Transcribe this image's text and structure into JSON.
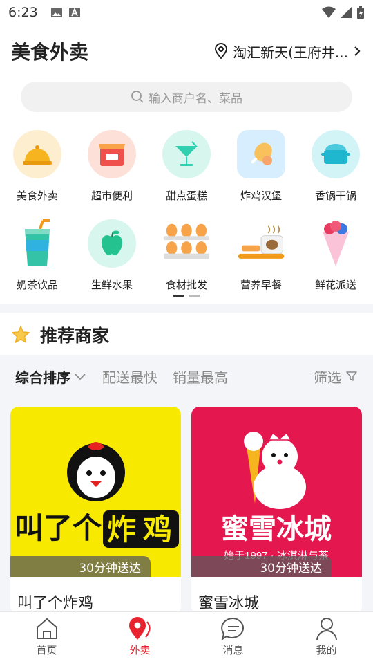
{
  "status_bar": {
    "time": "6:23"
  },
  "header": {
    "title": "美食外卖",
    "location": "淘汇新天(王府井..."
  },
  "search": {
    "placeholder": "输入商户名、菜品"
  },
  "categories": [
    {
      "label": "美食外卖",
      "icon": "dish-cloche-icon",
      "bg": "#fdeecf"
    },
    {
      "label": "超市便利",
      "icon": "store-icon",
      "bg": "#fde1d9"
    },
    {
      "label": "甜点蛋糕",
      "icon": "cocktail-icon",
      "bg": "#d6f6ee"
    },
    {
      "label": "炸鸡汉堡",
      "icon": "chicken-leg-icon",
      "bg": "#d7eefe"
    },
    {
      "label": "香锅干锅",
      "icon": "pot-icon",
      "bg": "#d3f4f7"
    },
    {
      "label": "奶茶饮品",
      "icon": "milk-tea-icon",
      "bg": "#ffffff"
    },
    {
      "label": "生鲜水果",
      "icon": "apple-icon",
      "bg": "#d6f6ee"
    },
    {
      "label": "食材批发",
      "icon": "eggs-icon",
      "bg": "#ffffff"
    },
    {
      "label": "营养早餐",
      "icon": "breakfast-icon",
      "bg": "#ffffff"
    },
    {
      "label": "鲜花派送",
      "icon": "flower-icon",
      "bg": "#ffffff"
    }
  ],
  "recommend": {
    "title": "推荐商家"
  },
  "sort": {
    "composite": "综合排序",
    "fastest": "配送最快",
    "top_sales": "销量最高",
    "filter": "筛选"
  },
  "merchants": [
    {
      "name": "叫了个炸鸡",
      "eta": "30分钟送达",
      "logo_text_a": "叫了个",
      "logo_text_b": "炸",
      "logo_text_c": "鸡",
      "bg": "#f7ea00"
    },
    {
      "name": "蜜雪冰城",
      "eta": "30分钟送达",
      "logo_text": "蜜雪冰城",
      "logo_sub": "始于1997 · 冰淇淋与茶",
      "bg": "#e5174f"
    }
  ],
  "bottom_nav": [
    {
      "label": "首页",
      "icon": "home-icon"
    },
    {
      "label": "外卖",
      "icon": "delivery-pin-icon",
      "active": true
    },
    {
      "label": "消息",
      "icon": "message-icon"
    },
    {
      "label": "我的",
      "icon": "profile-icon"
    }
  ],
  "colors": {
    "accent": "#e8232f",
    "page_bg": "#f3f5f8"
  }
}
